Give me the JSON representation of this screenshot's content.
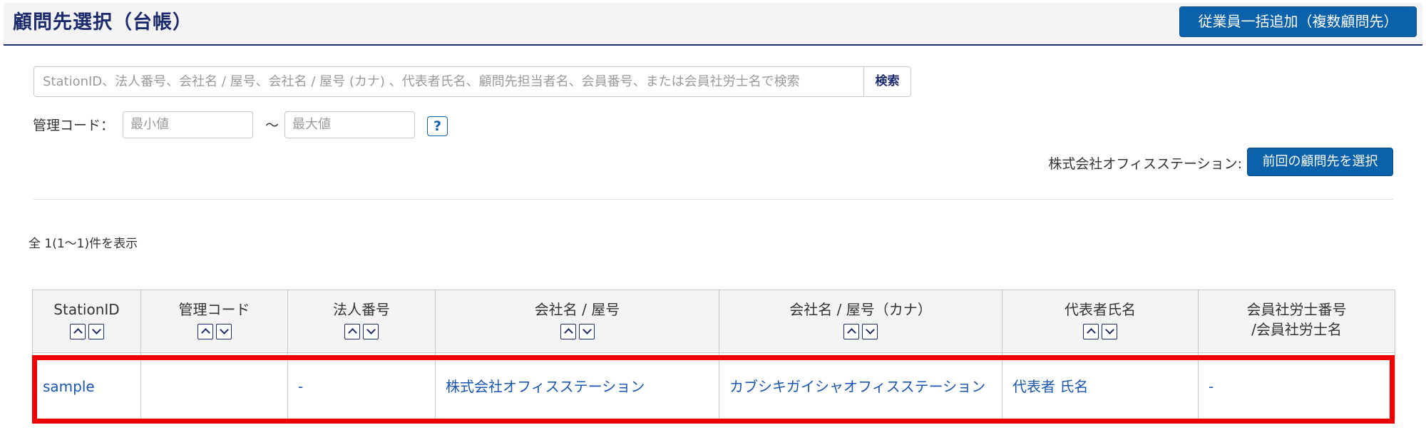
{
  "header": {
    "title": "顧問先選択（台帳）",
    "bulk_add_label": "従業員一括追加（複数顧問先）"
  },
  "search": {
    "placeholder": "StationID、法人番号、会社名 / 屋号、会社名 / 屋号 (カナ) 、代表者氏名、顧問先担当者名、会員番号、または会員社労士名で検索",
    "button_label": "検索"
  },
  "management_code": {
    "label": "管理コード：",
    "min_placeholder": "最小値",
    "separator": "～",
    "max_placeholder": "最大値",
    "help_label": "?"
  },
  "previous": {
    "company_label": "株式会社オフィスステーション:",
    "button_label": "前回の顧問先を選択"
  },
  "result_count": "全 1(1～1)件を表示",
  "table": {
    "columns": [
      {
        "label": "StationID",
        "sortable": true
      },
      {
        "label": "管理コード",
        "sortable": true
      },
      {
        "label": "法人番号",
        "sortable": true
      },
      {
        "label": "会社名 / 屋号",
        "sortable": true
      },
      {
        "label": "会社名 / 屋号（カナ）",
        "sortable": true
      },
      {
        "label": "代表者氏名",
        "sortable": true
      },
      {
        "label": "会員社労士番号",
        "label2": "/会員社労士名",
        "sortable": false
      }
    ],
    "rows": [
      [
        "sample",
        "",
        "-",
        "株式会社オフィスステーション",
        "カブシキガイシャオフィスステーション",
        "代表者 氏名",
        "-"
      ]
    ]
  },
  "colors": {
    "primary": "#0b61aa",
    "title": "#1c2a6e",
    "link": "#1a56b0",
    "highlight": "#ee0000"
  }
}
